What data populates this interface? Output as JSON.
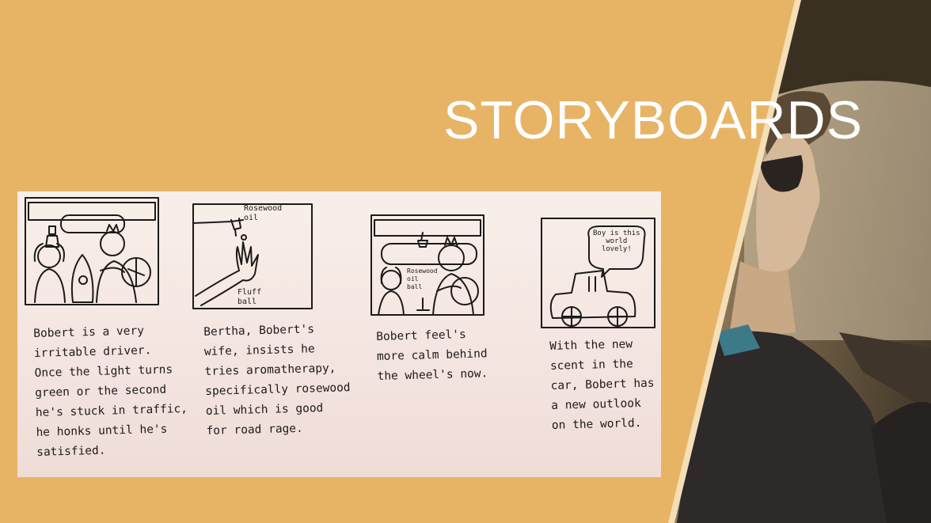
{
  "slide": {
    "title": "STORYBOARDS"
  },
  "storyboard": {
    "panels": [
      {
        "caption": "Bobert is a very\nirritable driver.\nOnce the light turns\ngreen or the second\nhe's stuck in traffic,\nhe honks until he's\nsatisfied."
      },
      {
        "labels": [
          "Rosewood\noil",
          "Fluff\nball"
        ],
        "caption": "Bertha, Bobert's\nwife, insists he\ntries aromatherapy,\nspecifically rosewood\noil which is good\nfor road rage."
      },
      {
        "labels": [
          "Rosewood\noil\nball"
        ],
        "caption": "Bobert feel's\nmore calm behind\nthe wheel's now."
      },
      {
        "speech": "Boy is this\nworld\nlovely!",
        "caption": "With the new\nscent in the\ncar, Bobert has\na new outlook\non the world."
      }
    ]
  },
  "colors": {
    "background": "#e7b466",
    "title": "#ffffff",
    "ink": "#1c1a1a"
  }
}
